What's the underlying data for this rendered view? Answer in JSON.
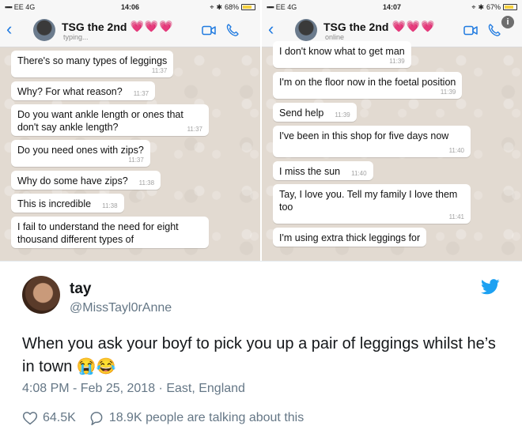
{
  "left_phone": {
    "status": {
      "carrier": "EE 4G",
      "time": "14:06",
      "battery": "68%"
    },
    "contact": {
      "name": "TSG the 2nd",
      "hearts": "💗💗💗",
      "status": "typing..."
    },
    "messages": [
      {
        "text": "There's so many types of leggings",
        "time": "11:37",
        "block": true
      },
      {
        "text": "Why? For what reason?",
        "time": "11:37",
        "block": false
      },
      {
        "text": "Do you want ankle length or ones that don't say ankle length?",
        "time": "11:37",
        "block": false
      },
      {
        "text": "Do you need ones with zips?",
        "time": "11:37",
        "block": true
      },
      {
        "text": "Why do some have zips?",
        "time": "11:38",
        "block": false
      },
      {
        "text": "This is incredible",
        "time": "11:38",
        "block": false
      },
      {
        "text": "I fail to understand the need for eight thousand different types of",
        "time": "",
        "block": false
      }
    ]
  },
  "right_phone": {
    "status": {
      "carrier": "EE 4G",
      "time": "14:07",
      "battery": "67%"
    },
    "contact": {
      "name": "TSG the 2nd",
      "hearts": "💗💗💗",
      "status": "online"
    },
    "messages": [
      {
        "text": "I don't know what to get man",
        "time": "11:39",
        "block": true
      },
      {
        "text": "I'm on the floor now in the foetal position",
        "time": "11:39",
        "block": true
      },
      {
        "text": "Send help",
        "time": "11:39",
        "block": false
      },
      {
        "text": "I've been in this shop for five days now",
        "time": "11:40",
        "block": false
      },
      {
        "text": "I miss the sun",
        "time": "11:40",
        "block": false
      },
      {
        "text": "Tay, I love you. Tell my family I love them too",
        "time": "11:41",
        "block": true
      },
      {
        "text": "I'm using extra thick leggings for",
        "time": "",
        "block": false
      }
    ]
  },
  "tweet": {
    "name": "tay",
    "handle": "@MissTayl0rAnne",
    "text": "When you ask your boyf to pick you up a pair of leggings whilst he’s in town 😭😂",
    "meta": "4:08 PM - Feb 25, 2018 · East, England",
    "likes": "64.5K",
    "talking": "18.9K people are talking about this"
  },
  "colors": {
    "accent": "#1da1f2",
    "ios_blue": "#1f7ae0",
    "hearts": "#e8489b",
    "muted": "#657786"
  },
  "icons": [
    "back-chevron-icon",
    "video-call-icon",
    "phone-icon",
    "info-icon",
    "twitter-bird-icon",
    "heart-icon",
    "reply-icon"
  ]
}
